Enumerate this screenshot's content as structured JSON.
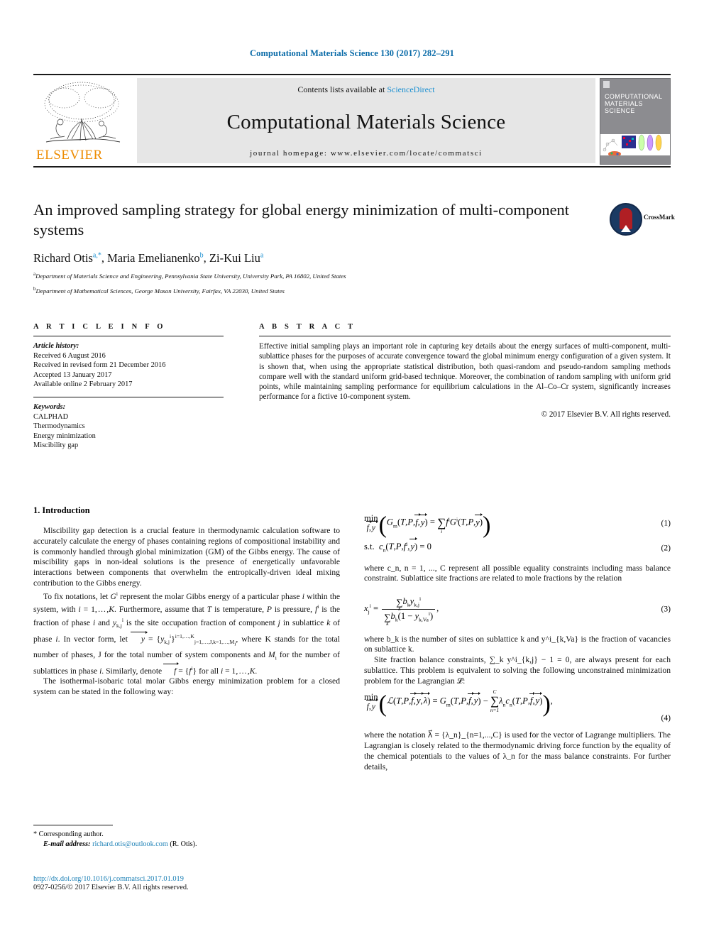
{
  "running_head": "Computational Materials Science 130 (2017) 282–291",
  "masthead": {
    "contents_prefix": "Contents lists available at ",
    "contents_link": "ScienceDirect",
    "journal_name": "Computational Materials Science",
    "homepage": "journal homepage: www.elsevier.com/locate/commatsci",
    "publisher": "ELSEVIER",
    "cover": {
      "line1": "COMPUTATIONAL",
      "line2": "MATERIALS",
      "line3": "SCIENCE"
    },
    "link_color": "#1a8fd1"
  },
  "article": {
    "title": "An improved sampling strategy for global energy minimization of multi-component systems",
    "authors": "Richard Otis a,*, Maria Emelianenko b, Zi-Kui Liu a",
    "author_list": [
      {
        "name": "Richard Otis",
        "marks": "a,*"
      },
      {
        "name": "Maria Emelianenko",
        "marks": "b"
      },
      {
        "name": "Zi-Kui Liu",
        "marks": "a"
      }
    ],
    "affiliations": [
      {
        "mark": "a",
        "text": "Department of Materials Science and Engineering, Pennsylvania State University, University Park, PA 16802, United States"
      },
      {
        "mark": "b",
        "text": "Department of Mathematical Sciences, George Mason University, Fairfax, VA 22030, United States"
      }
    ],
    "crossmark_label": "CrossMark"
  },
  "article_info": {
    "heading": "A R T I C L E   I N F O",
    "history_label": "Article history:",
    "history": [
      "Received 6 August 2016",
      "Received in revised form 21 December 2016",
      "Accepted 13 January 2017",
      "Available online 2 February 2017"
    ],
    "keywords_label": "Keywords:",
    "keywords": [
      "CALPHAD",
      "Thermodynamics",
      "Energy minimization",
      "Miscibility gap"
    ]
  },
  "abstract": {
    "heading": "A B S T R A C T",
    "text": "Effective initial sampling plays an important role in capturing key details about the energy surfaces of multi-component, multi-sublattice phases for the purposes of accurate convergence toward the global minimum energy configuration of a given system. It is shown that, when using the appropriate statistical distribution, both quasi-random and pseudo-random sampling methods compare well with the standard uniform grid-based technique. Moreover, the combination of random sampling with uniform grid points, while maintaining sampling performance for equilibrium calculations in the Al–Co–Cr system, significantly increases performance for a fictive 10-component system.",
    "copyright": "© 2017 Elsevier B.V. All rights reserved."
  },
  "section1": {
    "heading": "1. Introduction",
    "para1": "Miscibility gap detection is a crucial feature in thermodynamic calculation software to accurately calculate the energy of phases containing regions of compositional instability and is commonly handled through global minimization (GM) of the Gibbs energy. The cause of miscibility gaps in non-ideal solutions is the presence of energetically unfavorable interactions between components that overwhelm the entropically-driven ideal mixing contribution to the Gibbs energy.",
    "para2_a": "To fix notations, let ",
    "para2_b": " represent the molar Gibbs energy of a particular phase ",
    "para2_c": " within the system, with ",
    "para2_d": ". Furthermore, assume that ",
    "para2_e": " is temperature, ",
    "para2_f": " is pressure, ",
    "para2_g": " is the fraction of phase ",
    "para2_h": " and ",
    "para2_i": " is the site occupation fraction of component ",
    "para2_j": " in sublattice ",
    "para2_k": " of phase ",
    "para2_l": ". In vector form, let ",
    "para2_m": " where K stands for the total number of phases, J for the total number of system components and ",
    "para2_n": " for the number of sublattices in phase ",
    "para2_o": ". Similarly, denote ",
    "para2_p": " for all ",
    "para3": "The isothermal-isobaric total molar Gibbs energy minimization problem for a closed system can be stated in the following way:"
  },
  "right_column": {
    "eq1_number": "(1)",
    "eq2_label": "s.t.",
    "eq2_number": "(2)",
    "para_after_eq2": "where c_n, n = 1, ..., C represent all possible equality constraints including mass balance constraint. Sublattice site fractions are related to mole fractions by the relation",
    "eq3_number": "(3)",
    "para_after_eq3": "where b_k is the number of sites on sublattice k and y^i_{k,Va} is the fraction of vacancies on sublattice k.",
    "para_site_fraction": "Site fraction balance constraints, ∑_k y^i_{k,j} − 1 = 0, are always present for each sublattice. This problem is equivalent to solving the following unconstrained minimization problem for the Lagrangian 𝓛:",
    "eq4_number": "(4)",
    "para_after_eq4": "where the notation λ⃗ = {λ_n}_{n=1,...,C} is used for the vector of Lagrange multipliers. The Lagrangian is closely related to the thermodynamic driving force function by the equality of the chemical potentials to the values of λ_n for the mass balance constraints. For further details,"
  },
  "footnote": {
    "corresponding": "* Corresponding author.",
    "email_label": "E-mail address:",
    "email": "richard.otis@outlook.com",
    "email_suffix": "(R. Otis)."
  },
  "footer": {
    "doi": "http://dx.doi.org/10.1016/j.commatsci.2017.01.019",
    "issn": "0927-0256/© 2017 Elsevier B.V. All rights reserved."
  }
}
